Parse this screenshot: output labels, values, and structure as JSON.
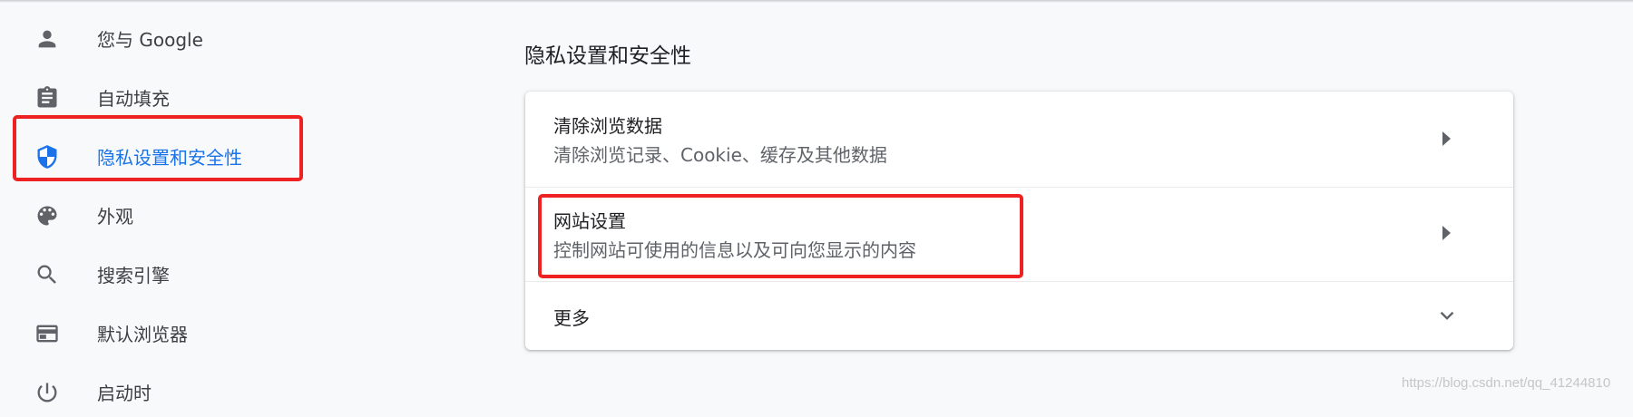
{
  "sidebar": {
    "items": [
      {
        "label": "您与 Google",
        "icon": "person-icon"
      },
      {
        "label": "自动填充",
        "icon": "clipboard-icon"
      },
      {
        "label": "隐私设置和安全性",
        "icon": "shield-icon",
        "active": true
      },
      {
        "label": "外观",
        "icon": "palette-icon"
      },
      {
        "label": "搜索引擎",
        "icon": "search-icon"
      },
      {
        "label": "默认浏览器",
        "icon": "browser-window-icon"
      },
      {
        "label": "启动时",
        "icon": "power-icon"
      }
    ]
  },
  "main": {
    "section_title": "隐私设置和安全性",
    "rows": [
      {
        "title": "清除浏览数据",
        "subtitle": "清除浏览记录、Cookie、缓存及其他数据",
        "icon": "arrow-right-icon"
      },
      {
        "title": "网站设置",
        "subtitle": "控制网站可使用的信息以及可向您显示的内容",
        "icon": "arrow-right-icon"
      },
      {
        "title": "更多",
        "icon": "chevron-down-icon"
      }
    ]
  },
  "watermark": "https://blog.csdn.net/qq_41244810",
  "colors": {
    "accent": "#1a73e8",
    "highlight": "#ee2222",
    "background": "#f8f9fa",
    "icon": "#5f6368"
  }
}
